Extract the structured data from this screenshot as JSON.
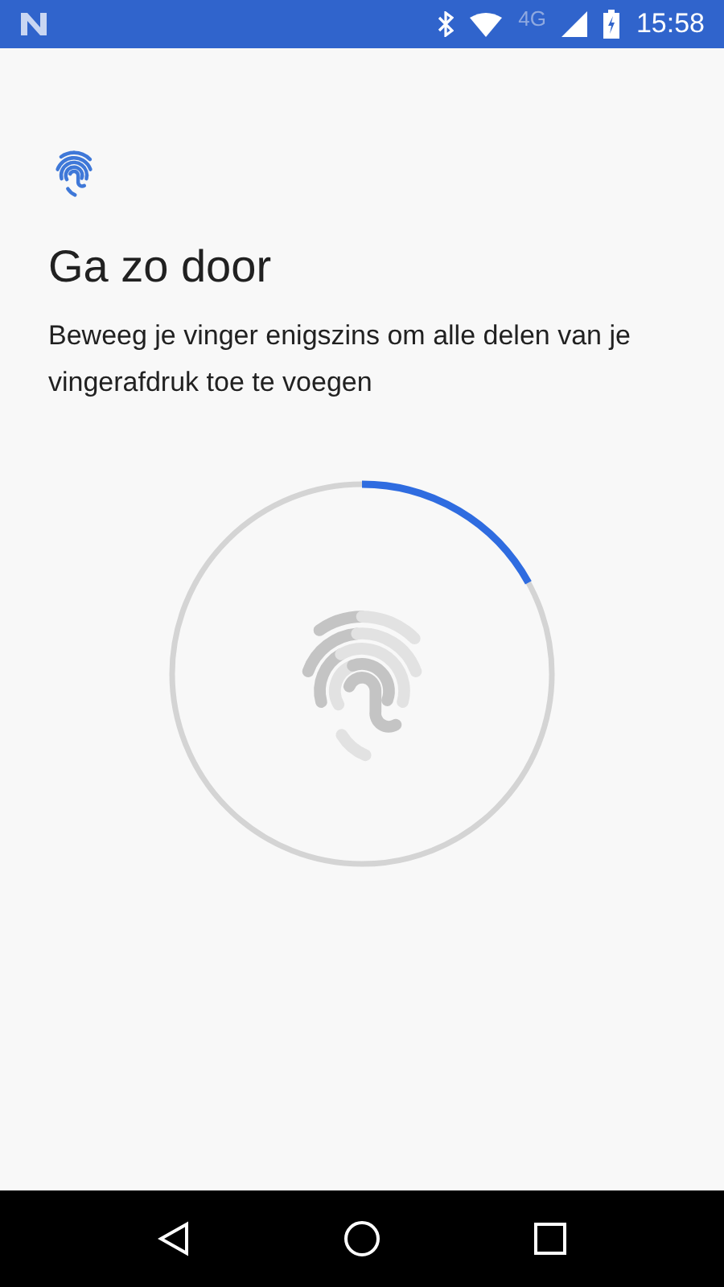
{
  "status_bar": {
    "network": "4G",
    "time": "15:58"
  },
  "title": "Ga zo door",
  "description": "Beweeg je vinger enigszins om alle delen van je vingerafdruk toe te voegen",
  "progress": {
    "level": 0.17
  }
}
